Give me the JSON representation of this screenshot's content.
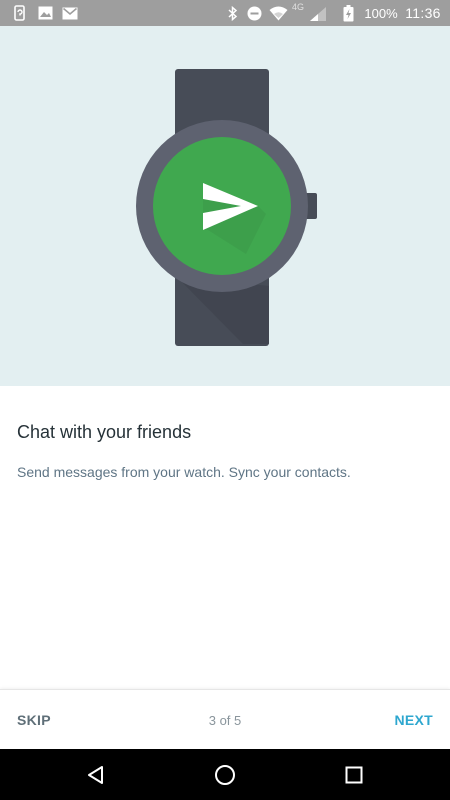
{
  "status_bar": {
    "time": "11:36",
    "battery_percent": "100%",
    "network_label": "4G",
    "left_icons": [
      "phone-sync-icon",
      "gallery-icon",
      "gmail-icon"
    ],
    "right_icons": [
      "bluetooth-icon",
      "do-not-disturb-icon",
      "wifi-icon",
      "cell-signal-icon",
      "battery-charging-icon"
    ]
  },
  "hero": {
    "illustration": "smartwatch-send-icon",
    "colors": {
      "background": "#e3eff1",
      "strap": "#474c57",
      "bezel": "#5e6270",
      "face": "#40a84f",
      "glyph": "#ffffff"
    }
  },
  "content": {
    "title": "Chat with your friends",
    "description": "Send messages from your watch. Sync your contacts."
  },
  "onboarding": {
    "skip_label": "SKIP",
    "page_indicator": "3 of 5",
    "next_label": "NEXT",
    "accent_color": "#2ea7cf"
  },
  "system_nav": {
    "buttons": [
      "back-icon",
      "home-icon",
      "recents-icon"
    ]
  }
}
